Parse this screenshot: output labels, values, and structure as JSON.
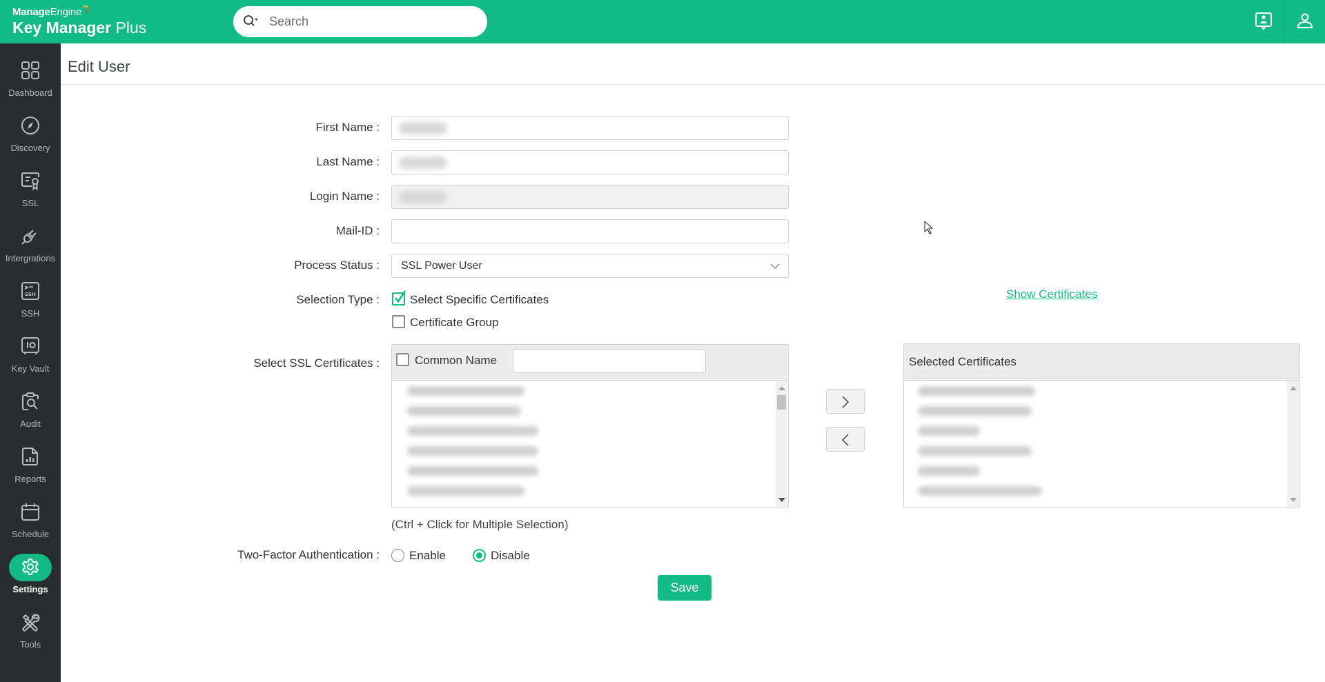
{
  "header": {
    "brand_bold": "Manage",
    "brand_rest": "Engine",
    "product_name": "Key Manager",
    "product_suffix": " Plus",
    "search_placeholder": "Search",
    "icons": [
      "announcement-icon",
      "user-profile-icon"
    ],
    "accent_color": "#12bb84"
  },
  "sidebar": {
    "items": [
      {
        "label": "Dashboard",
        "icon": "dashboard-grid-icon",
        "active": false
      },
      {
        "label": "Discovery",
        "icon": "compass-icon",
        "active": false
      },
      {
        "label": "SSL",
        "icon": "certificate-icon",
        "active": false
      },
      {
        "label": "Intergrations",
        "icon": "plug-icon",
        "active": false
      },
      {
        "label": "SSH",
        "icon": "ssh-terminal-icon",
        "active": false
      },
      {
        "label": "Key Vault",
        "icon": "vault-icon",
        "active": false
      },
      {
        "label": "Audit",
        "icon": "audit-clipboard-icon",
        "active": false
      },
      {
        "label": "Reports",
        "icon": "report-chart-icon",
        "active": false
      },
      {
        "label": "Schedule",
        "icon": "calendar-icon",
        "active": false
      },
      {
        "label": "Settings",
        "icon": "gear-icon",
        "active": true
      },
      {
        "label": "Tools",
        "icon": "tools-icon",
        "active": false
      }
    ]
  },
  "page": {
    "title": "Edit User"
  },
  "form": {
    "first_name_label": "First Name  :",
    "last_name_label": "Last Name  :",
    "login_name_label": "Login Name  :",
    "mail_id_label": "Mail-ID  :",
    "mail_id_value": "",
    "process_status_label": "Process Status  :",
    "process_status_value": "SSL Power User",
    "selection_type_label": "Selection Type  :",
    "selection_options": [
      {
        "label": "Select Specific Certificates",
        "checked": true
      },
      {
        "label": "Certificate Group",
        "checked": false
      }
    ],
    "show_certificates_link": "Show Certificates",
    "select_ssl_label": "Select SSL Certificates  :",
    "common_name_label": "Common Name",
    "common_name_value": "",
    "available_list_count_visible": 6,
    "selected_header": "Selected Certificates",
    "selected_list_count_visible": 6,
    "move_right_label": ">",
    "move_left_label": "<",
    "multi_select_hint": "(Ctrl + Click for Multiple Selection)",
    "two_factor_label": "Two-Factor Authentication  :",
    "two_factor_options": [
      {
        "label": "Enable",
        "checked": false
      },
      {
        "label": "Disable",
        "checked": true
      }
    ],
    "save_label": "Save"
  }
}
